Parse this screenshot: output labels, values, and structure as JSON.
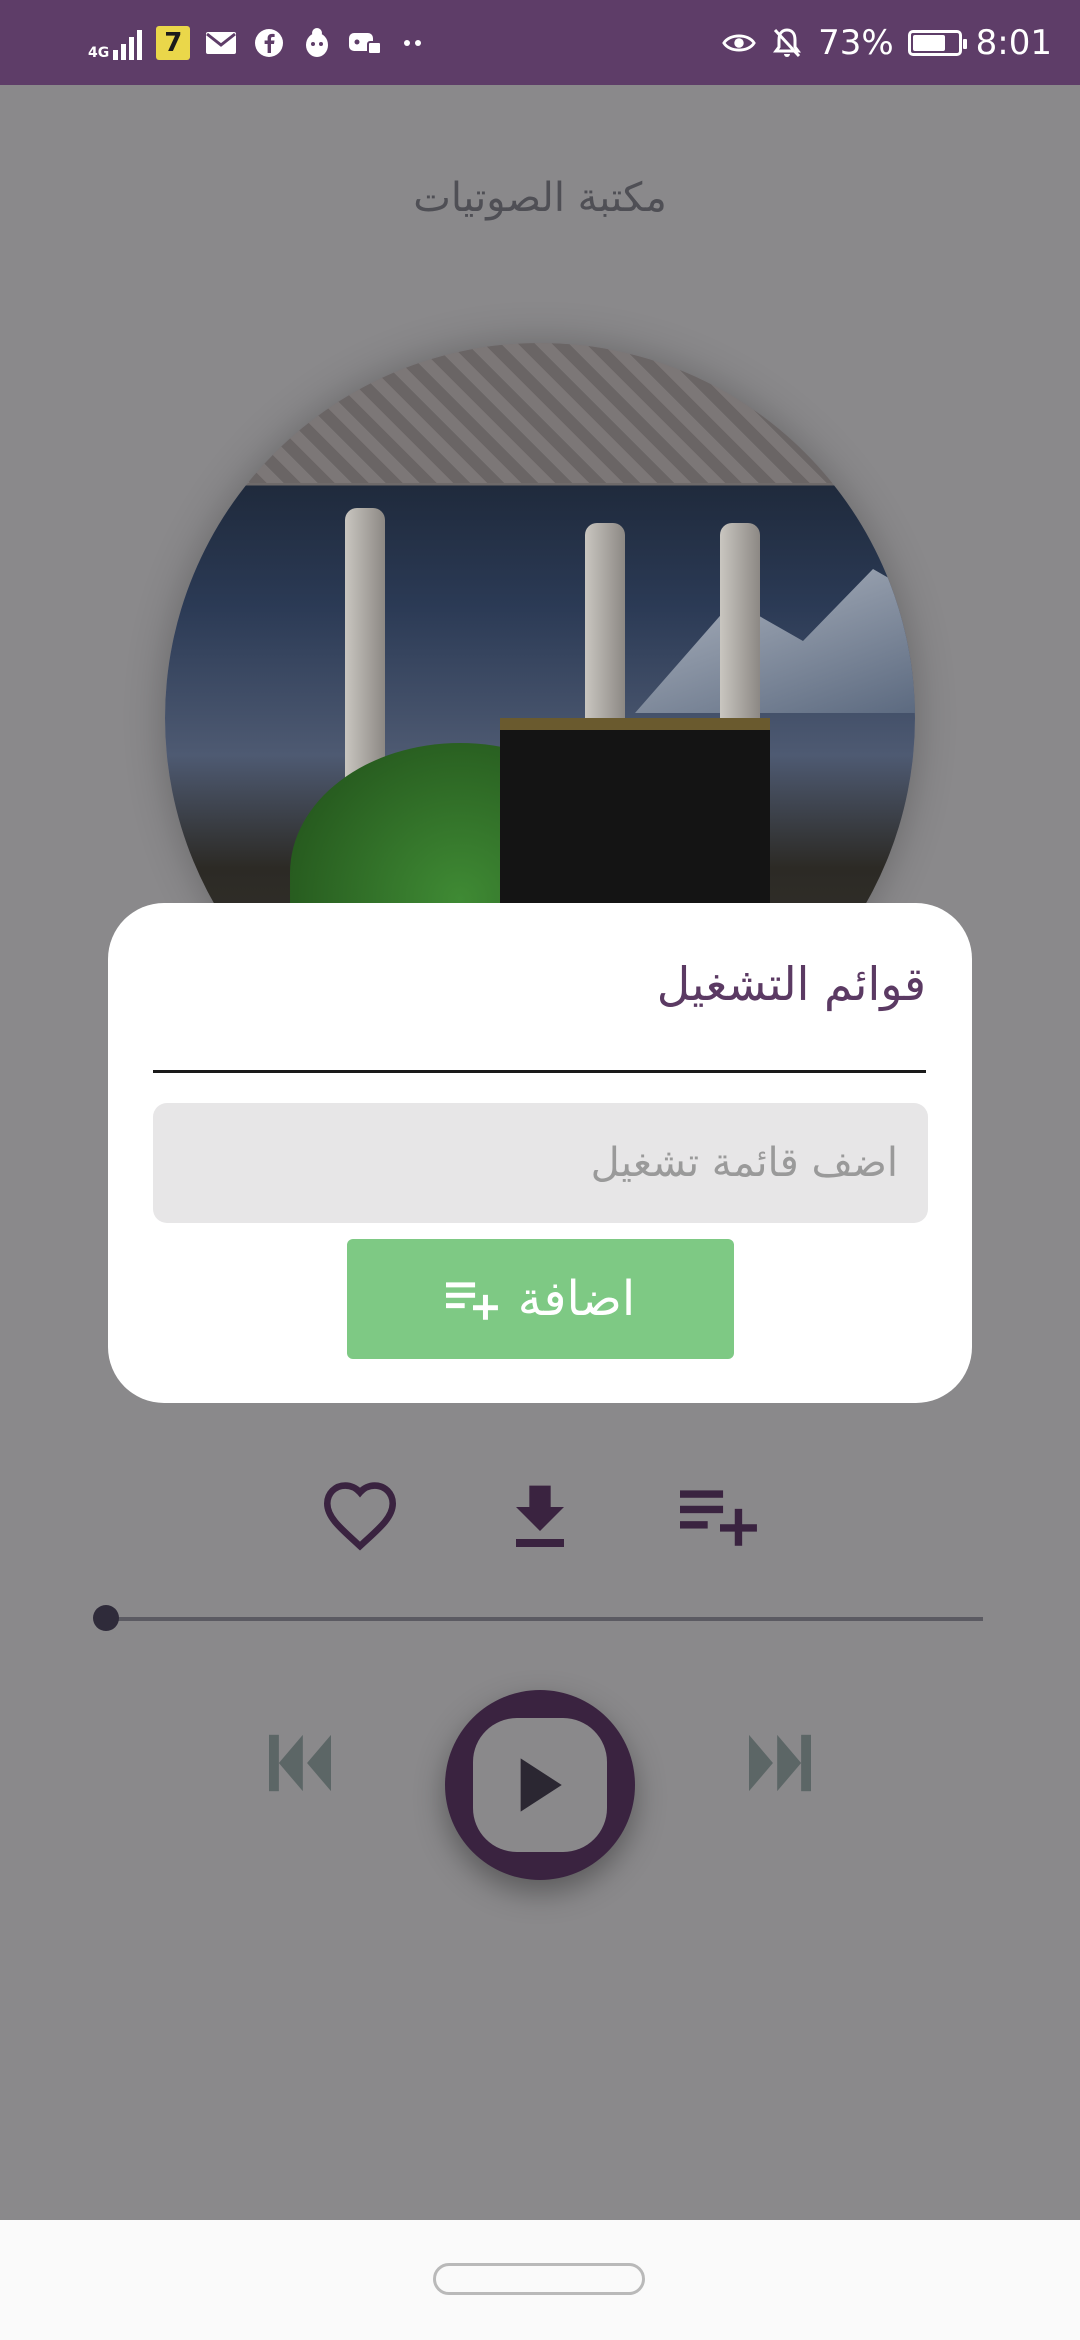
{
  "status_bar": {
    "network_label": "4G",
    "badge_text": "7",
    "battery": "73%",
    "battery_level": 0.73,
    "time": "8:01",
    "icons": [
      "signal-icon",
      "app-badge-icon",
      "mail-icon",
      "facebook-icon",
      "app-icon",
      "gamepad-icon",
      "more-dots-icon",
      "eye-icon",
      "bell-off-icon",
      "battery-icon"
    ]
  },
  "app": {
    "title": "مكتبة الصوتيات",
    "background": "#8a898b"
  },
  "dialog": {
    "title": "قوائم التشغيل",
    "input_placeholder": "اضف قائمة تشغيل",
    "input_value": "",
    "add_label": "اضافة",
    "add_color": "#7ec984",
    "title_color": "#5b3a63"
  },
  "player": {
    "actions": [
      "heart-icon",
      "download-icon",
      "playlist-add-icon"
    ],
    "progress": 0,
    "controls": [
      "skip-previous-icon",
      "play-icon",
      "skip-next-icon"
    ],
    "accent": "#3a2340"
  }
}
